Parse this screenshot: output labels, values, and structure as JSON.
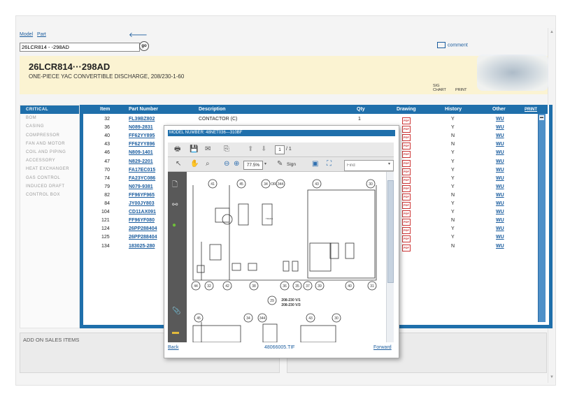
{
  "nav": {
    "model_link": "Model",
    "part_link": "Part"
  },
  "search": {
    "value": "26LCR814 - -298AD"
  },
  "go_label": "go",
  "comment_label": "comment",
  "model": {
    "title": "26LCR814···298AD",
    "description": "ONE-PIECE YAC CONVERTIBLE DISCHARGE, 208/230-1-60"
  },
  "header_actions": {
    "sig_line1": "SIG",
    "sig_line2": "CHART",
    "print": "PRINT"
  },
  "sidebar": {
    "items": [
      {
        "label": "CRITICAL",
        "active": true
      },
      {
        "label": "BOM"
      },
      {
        "label": "CASING"
      },
      {
        "label": "COMPRESSOR"
      },
      {
        "label": "FAN AND MOTOR"
      },
      {
        "label": "COIL AND PIPING"
      },
      {
        "label": "ACCESSORY"
      },
      {
        "label": "HEAT EXCHANGER"
      },
      {
        "label": "GAS CONTROL"
      },
      {
        "label": "INDUCED DRAFT"
      },
      {
        "label": "CONTROL BOX"
      }
    ]
  },
  "table": {
    "headers": {
      "item": "Item",
      "part_number": "Part Number",
      "description": "Description",
      "qty": "Qty",
      "drawing": "Drawing",
      "history": "History",
      "other": "Other",
      "print": "PRINT"
    },
    "rows": [
      {
        "item": "32",
        "part": "FL39BZ802",
        "desc": "CONTACTOR (C)",
        "qty": "1",
        "history": "Y",
        "other": "WU"
      },
      {
        "item": "36",
        "part": "N089-2831",
        "desc": "",
        "qty": "",
        "history": "Y",
        "other": "WU"
      },
      {
        "item": "40",
        "part": "FF62YY895",
        "desc": "",
        "qty": "",
        "history": "N",
        "other": "WU"
      },
      {
        "item": "43",
        "part": "FF62YY896",
        "desc": "",
        "qty": "",
        "history": "N",
        "other": "WU"
      },
      {
        "item": "46",
        "part": "N809-1401",
        "desc": "",
        "qty": "",
        "history": "Y",
        "other": "WU"
      },
      {
        "item": "47",
        "part": "N829-2201",
        "desc": "",
        "qty": "",
        "history": "Y",
        "other": "WU"
      },
      {
        "item": "70",
        "part": "FA17EC015",
        "desc": "",
        "qty": "",
        "history": "Y",
        "other": "WU"
      },
      {
        "item": "74",
        "part": "FA23YC086",
        "desc": "",
        "qty": "",
        "history": "Y",
        "other": "WU"
      },
      {
        "item": "79",
        "part": "N079-9381",
        "desc": "",
        "qty": "",
        "history": "Y",
        "other": "WU"
      },
      {
        "item": "82",
        "part": "FF96YF965",
        "desc": "",
        "qty": "",
        "history": "N",
        "other": "WU"
      },
      {
        "item": "84",
        "part": "JY00JY803",
        "desc": "",
        "qty": "",
        "history": "Y",
        "other": "WU"
      },
      {
        "item": "104",
        "part": "CD11AX091",
        "desc": "",
        "qty": "",
        "history": "Y",
        "other": "WU"
      },
      {
        "item": "121",
        "part": "FF96YF080",
        "desc": "",
        "qty": "",
        "history": "N",
        "other": "WU"
      },
      {
        "item": "124",
        "part": "26PP288404",
        "desc": "",
        "qty": "",
        "history": "Y",
        "other": "WU"
      },
      {
        "item": "125",
        "part": "26PP288404",
        "desc": "",
        "qty": "",
        "history": "Y",
        "other": "WU"
      },
      {
        "item": "134",
        "part": "183025-280",
        "desc": "",
        "qty": "",
        "history": "N",
        "other": "WU"
      }
    ]
  },
  "addon_title": "ADD ON SALES ITEMS",
  "popup": {
    "title": "MODEL NUMBER: 48NET036---310BF",
    "page_current": "1",
    "page_total": "/ 1",
    "zoom": "77.5%",
    "sign_label": "Sign",
    "find_placeholder": "Find",
    "back_label": "Back",
    "filename": "48066005.TIF",
    "forward_label": "Forward",
    "diagram": {
      "callouts_top": [
        "41",
        "45",
        "34",
        "344",
        "43",
        "30"
      ],
      "callouts_bottom": [
        "44",
        "32",
        "42",
        "38",
        "36",
        "35",
        "37",
        "39",
        "40",
        "31"
      ],
      "callout_mid": "29",
      "voltage_1": "208-230 V/1",
      "voltage_3": "208-230 V/3",
      "or_label": "OR",
      "callouts_lower": [
        "45",
        "34",
        "344",
        "43",
        "30"
      ],
      "trans_label": "TRANS"
    }
  }
}
